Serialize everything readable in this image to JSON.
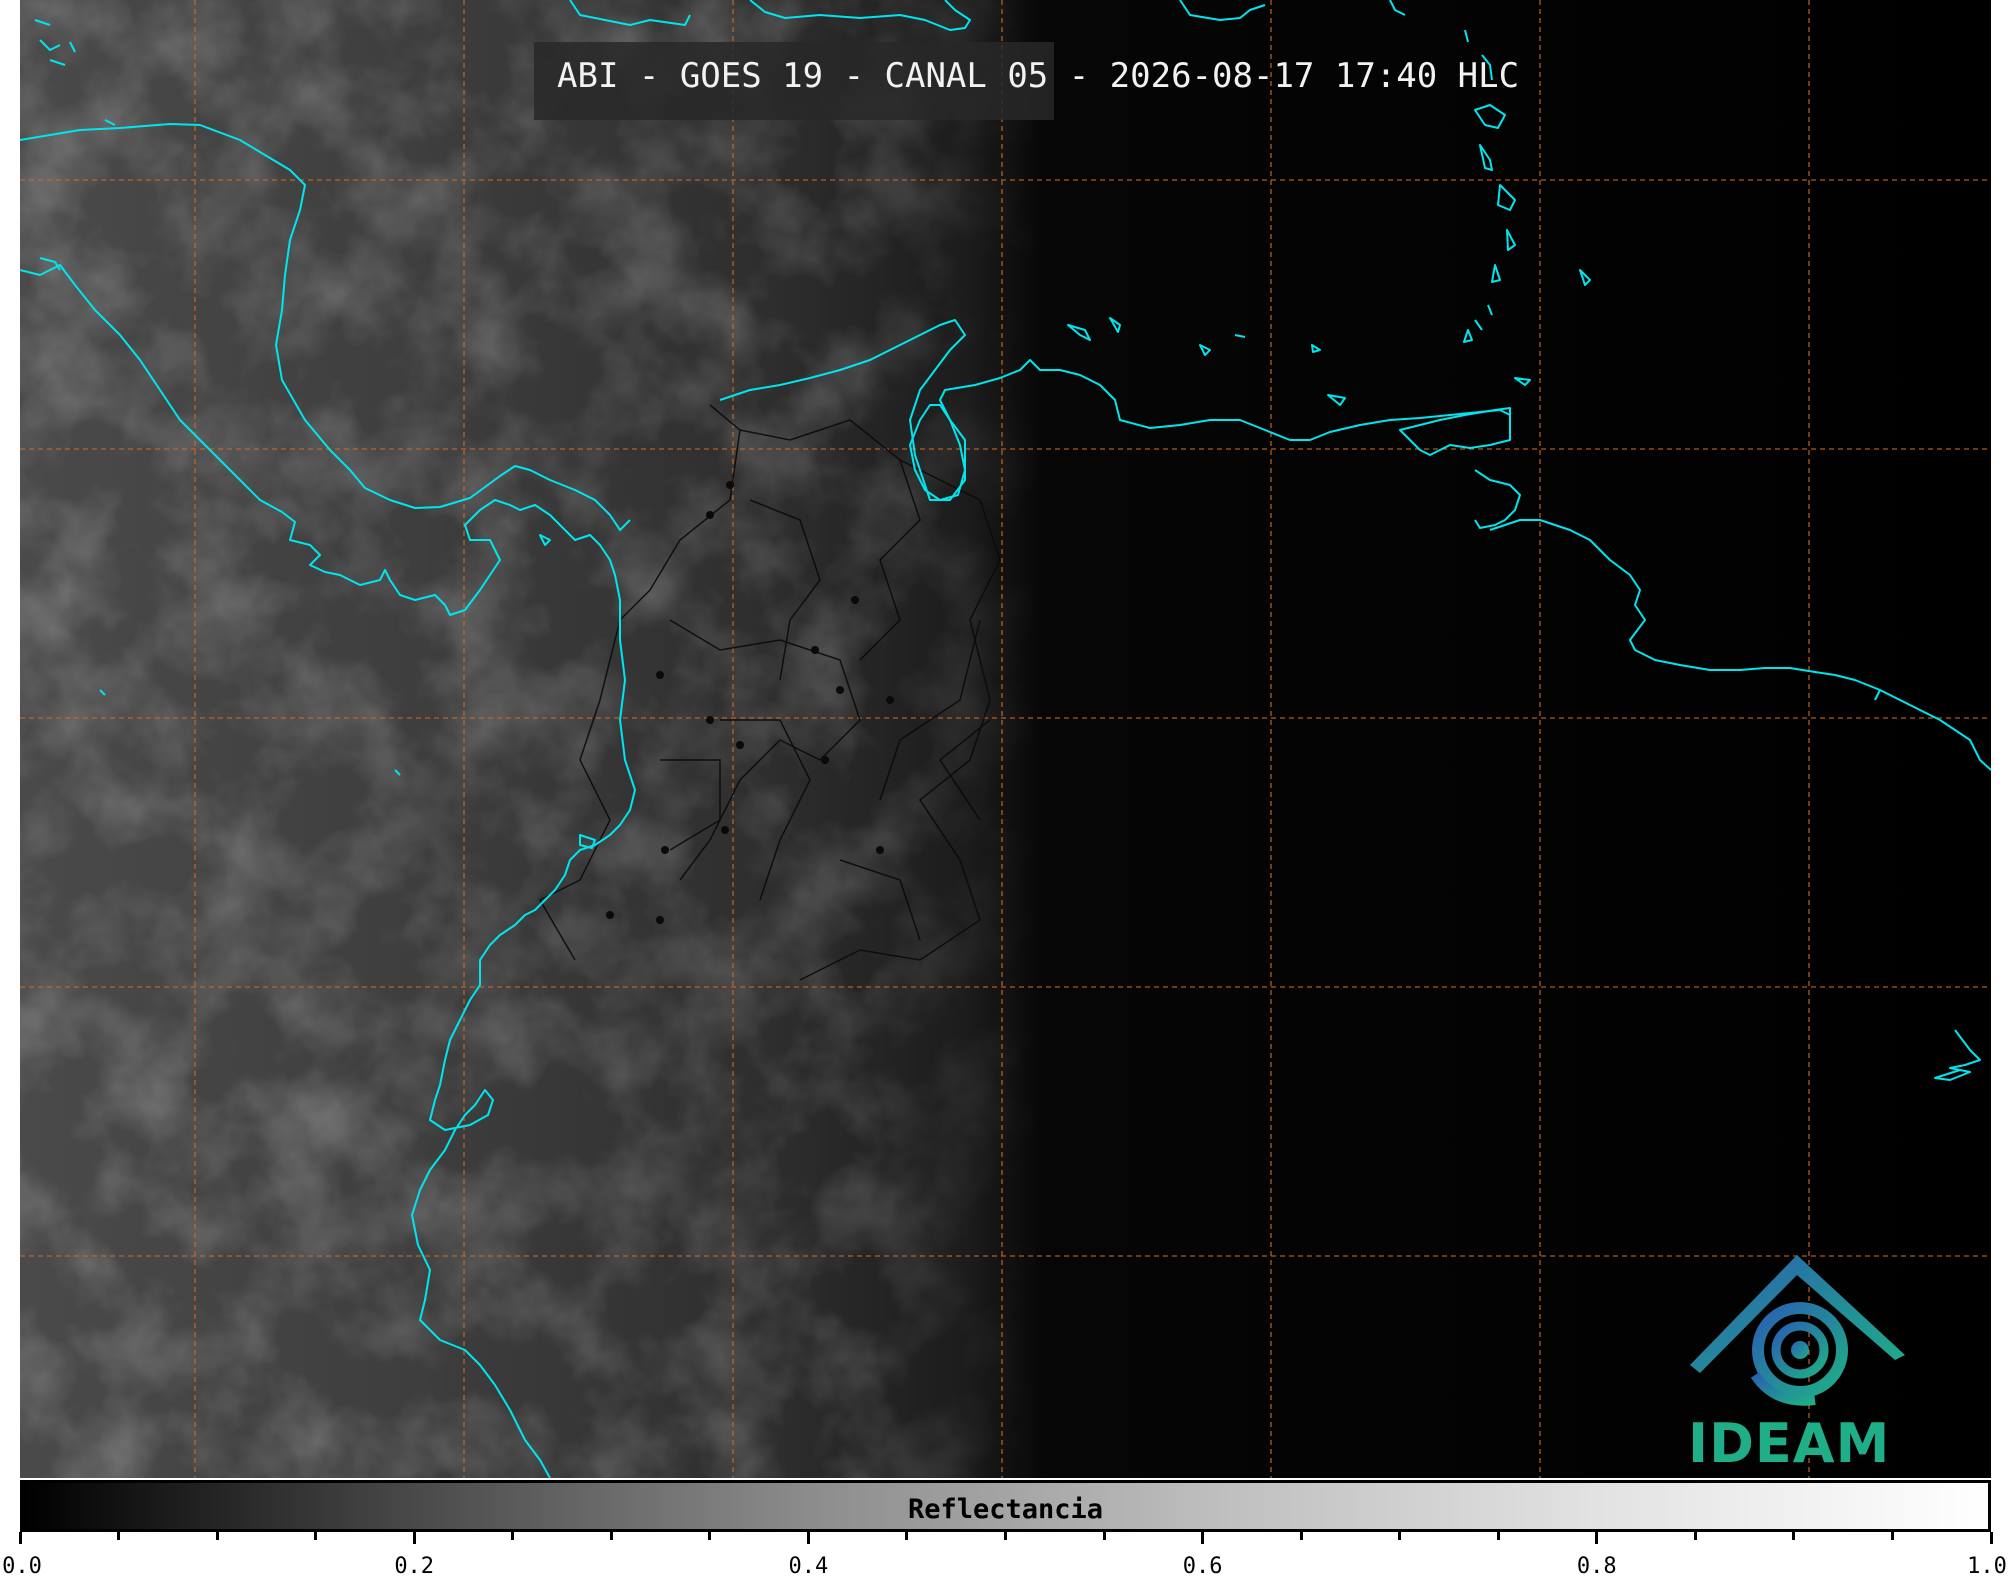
{
  "title": "ABI - GOES 19 - CANAL 05 - 2026-08-17 17:40 HLC",
  "logo": {
    "text": "IDEAM",
    "color": "#1fae87",
    "icon": "ideam-logo-icon"
  },
  "colorbar": {
    "label": "Reflectancia",
    "ticks": [
      "0.0",
      "0.2",
      "0.4",
      "0.6",
      "0.8",
      "1.0"
    ],
    "range": [
      0.0,
      1.0
    ]
  },
  "colors": {
    "coastline": "#00e5ee",
    "gridlines": "#d2691e",
    "borders": "#000000"
  }
}
